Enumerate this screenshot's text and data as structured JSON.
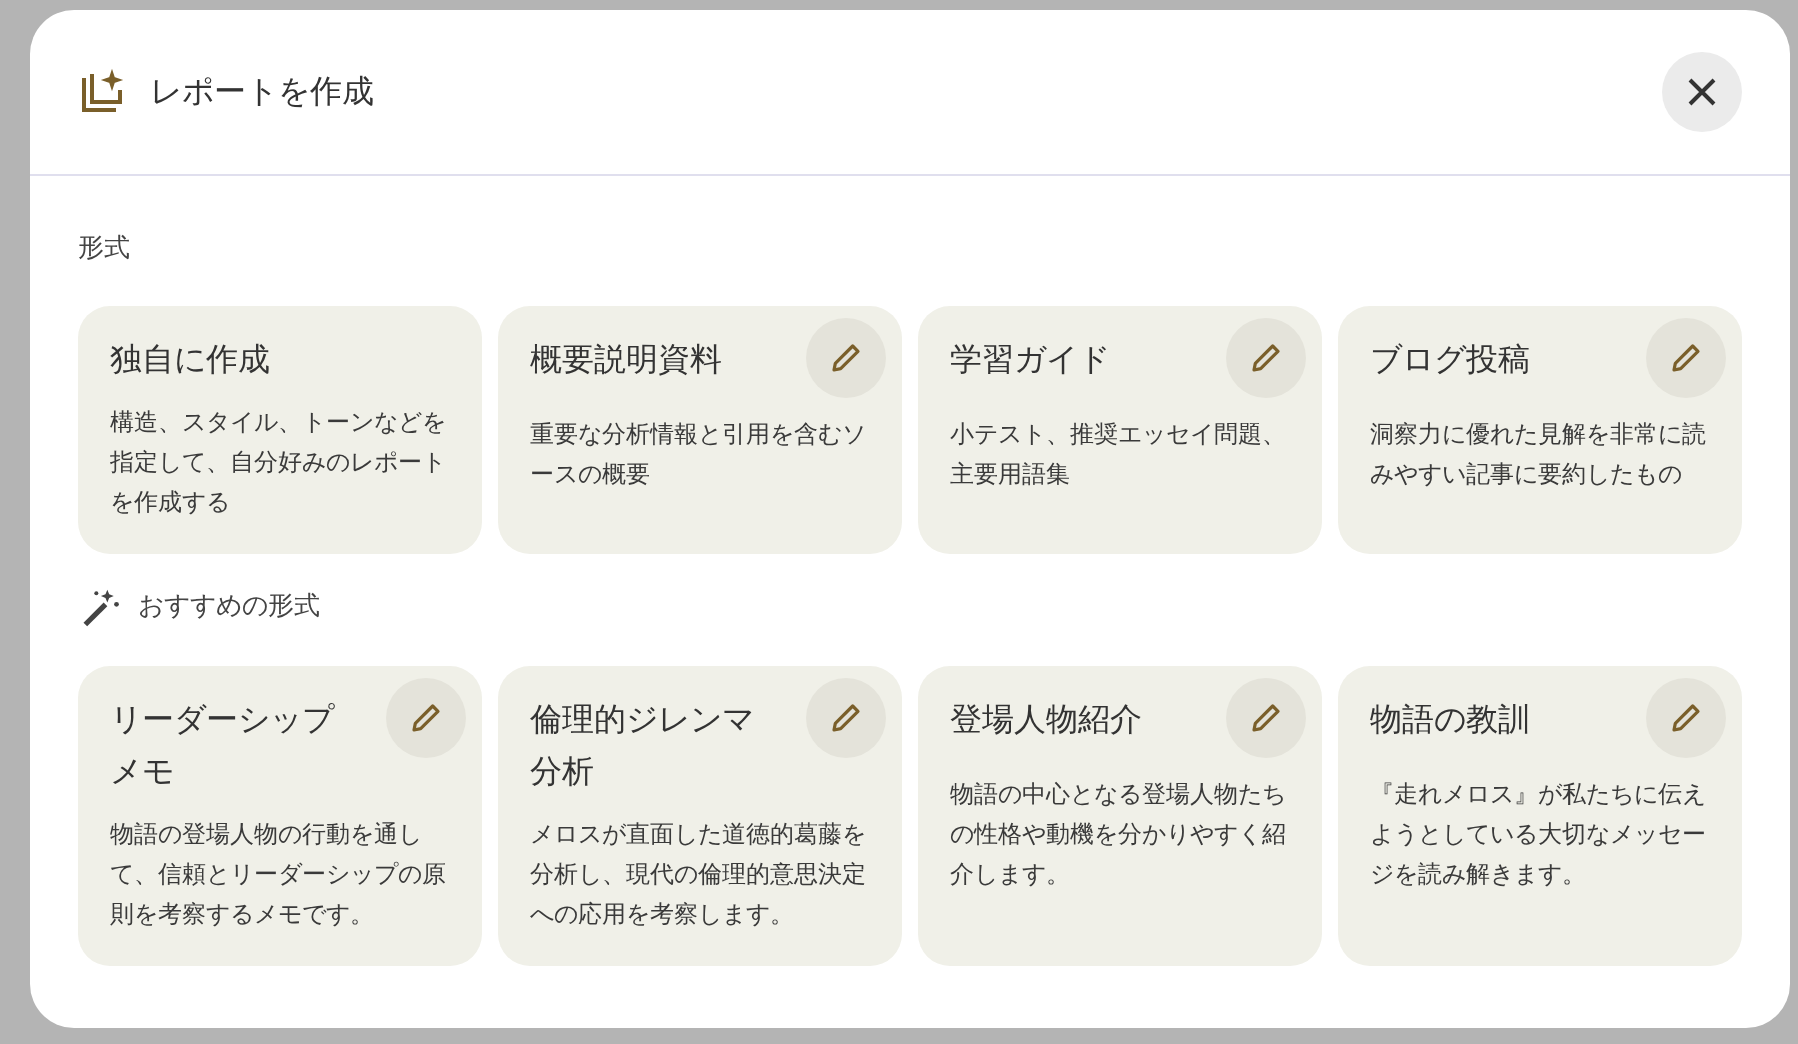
{
  "dialog": {
    "title": "レポートを作成"
  },
  "formats": {
    "heading": "形式",
    "cards": [
      {
        "title": "独自に作成",
        "description": "構造、スタイル、トーンなどを指定して、自分好みのレポートを作成する",
        "editable": false
      },
      {
        "title": "概要説明資料",
        "description": "重要な分析情報と引用を含むソースの概要",
        "editable": true
      },
      {
        "title": "学習ガイド",
        "description": "小テスト、推奨エッセイ問題、主要用語集",
        "editable": true
      },
      {
        "title": "ブログ投稿",
        "description": "洞察力に優れた見解を非常に読みやすい記事に要約したもの",
        "editable": true
      }
    ]
  },
  "suggested": {
    "heading": "おすすめの形式",
    "cards": [
      {
        "title": "リーダーシップメモ",
        "description": "物語の登場人物の行動を通して、信頼とリーダーシップの原則を考察するメモです。",
        "editable": true
      },
      {
        "title": "倫理的ジレンマ分析",
        "description": "メロスが直面した道徳的葛藤を分析し、現代の倫理的意思決定への応用を考察します。",
        "editable": true
      },
      {
        "title": "登場人物紹介",
        "description": "物語の中心となる登場人物たちの性格や動機を分かりやすく紹介します。",
        "editable": true
      },
      {
        "title": "物語の教訓",
        "description": "『走れメロス』が私たちに伝えようとしている大切なメッセージを読み解きます。",
        "editable": true
      }
    ]
  }
}
